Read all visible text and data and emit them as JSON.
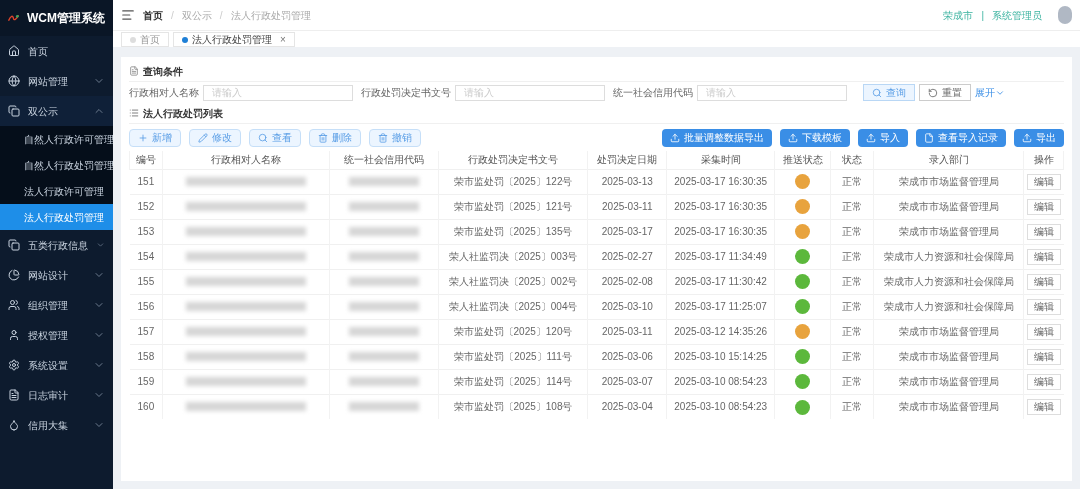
{
  "app": {
    "title": "WCM管理系统"
  },
  "sidebar": {
    "items": [
      {
        "label": "首页",
        "kind": "link"
      },
      {
        "label": "网站管理",
        "kind": "group",
        "expanded": false
      },
      {
        "label": "双公示",
        "kind": "group",
        "expanded": true,
        "children": [
          {
            "label": "自然人行政许可管理",
            "selected": false
          },
          {
            "label": "自然人行政处罚管理",
            "selected": false
          },
          {
            "label": "法人行政许可管理",
            "selected": false
          },
          {
            "label": "法人行政处罚管理",
            "selected": true
          }
        ]
      },
      {
        "label": "五类行政信息",
        "kind": "group",
        "expanded": false
      },
      {
        "label": "网站设计",
        "kind": "group",
        "expanded": false
      },
      {
        "label": "组织管理",
        "kind": "group",
        "expanded": false
      },
      {
        "label": "授权管理",
        "kind": "group",
        "expanded": false
      },
      {
        "label": "系统设置",
        "kind": "group",
        "expanded": false
      },
      {
        "label": "日志审计",
        "kind": "group",
        "expanded": false
      },
      {
        "label": "信用大集",
        "kind": "group",
        "expanded": false
      }
    ]
  },
  "breadcrumb": {
    "separator": "/",
    "items": [
      "首页",
      "双公示",
      "法人行政处罚管理"
    ]
  },
  "user": {
    "region": "荣成市",
    "separator": "|",
    "role": "系统管理员"
  },
  "tabs": [
    {
      "label": "首页",
      "selected": false
    },
    {
      "label": "法人行政处罚管理",
      "selected": true,
      "close": "×"
    }
  ],
  "query": {
    "title": "查询条件",
    "fields": [
      {
        "label": "行政相对人名称",
        "placeholder": "请输入"
      },
      {
        "label": "行政处罚决定书文号",
        "placeholder": "请输入"
      },
      {
        "label": "统一社会信用代码",
        "placeholder": "请输入"
      }
    ],
    "search_button": "查询",
    "reset_button": "重置",
    "expand_link": "展开"
  },
  "list": {
    "title": "法人行政处罚列表",
    "left_buttons": [
      "新增",
      "修改",
      "查看",
      "删除",
      "撤销"
    ],
    "right_buttons": [
      "批量调整数据导出",
      "下载模板",
      "导入",
      "查看导入记录",
      "导出"
    ]
  },
  "table": {
    "columns": [
      "编号",
      "行政相对人名称",
      "统一社会信用代码",
      "行政处罚决定书文号",
      "处罚决定日期",
      "采集时间",
      "推送状态",
      "状态",
      "录入部门",
      "操作"
    ],
    "rows": [
      {
        "id": "151",
        "doc_no": "荣市监处罚〔2025〕122号",
        "date": "2025-03-13",
        "collected": "2025-03-17 16:30:35",
        "color": "#e8a33d",
        "status": "正常",
        "dept": "荣成市市场监督管理局",
        "action": "编辑"
      },
      {
        "id": "152",
        "doc_no": "荣市监处罚〔2025〕121号",
        "date": "2025-03-11",
        "collected": "2025-03-17 16:30:35",
        "color": "#e8a33d",
        "status": "正常",
        "dept": "荣成市市场监督管理局",
        "action": "编辑"
      },
      {
        "id": "153",
        "doc_no": "荣市监处罚〔2025〕135号",
        "date": "2025-03-17",
        "collected": "2025-03-17 16:30:35",
        "color": "#e8a33d",
        "status": "正常",
        "dept": "荣成市市场监督管理局",
        "action": "编辑"
      },
      {
        "id": "154",
        "doc_no": "荣人社监罚决〔2025〕003号",
        "date": "2025-02-27",
        "collected": "2025-03-17 11:34:49",
        "color": "#5cb83c",
        "status": "正常",
        "dept": "荣成市人力资源和社会保障局",
        "action": "编辑"
      },
      {
        "id": "155",
        "doc_no": "荣人社监罚决〔2025〕002号",
        "date": "2025-02-08",
        "collected": "2025-03-17 11:30:42",
        "color": "#5cb83c",
        "status": "正常",
        "dept": "荣成市人力资源和社会保障局",
        "action": "编辑"
      },
      {
        "id": "156",
        "doc_no": "荣人社监罚决〔2025〕004号",
        "date": "2025-03-10",
        "collected": "2025-03-17 11:25:07",
        "color": "#5cb83c",
        "status": "正常",
        "dept": "荣成市人力资源和社会保障局",
        "action": "编辑"
      },
      {
        "id": "157",
        "doc_no": "荣市监处罚〔2025〕120号",
        "date": "2025-03-11",
        "collected": "2025-03-12 14:35:26",
        "color": "#e8a33d",
        "status": "正常",
        "dept": "荣成市市场监督管理局",
        "action": "编辑"
      },
      {
        "id": "158",
        "doc_no": "荣市监处罚〔2025〕111号",
        "date": "2025-03-06",
        "collected": "2025-03-10 15:14:25",
        "color": "#5cb83c",
        "status": "正常",
        "dept": "荣成市市场监督管理局",
        "action": "编辑"
      },
      {
        "id": "159",
        "doc_no": "荣市监处罚〔2025〕114号",
        "date": "2025-03-07",
        "collected": "2025-03-10 08:54:23",
        "color": "#5cb83c",
        "status": "正常",
        "dept": "荣成市市场监督管理局",
        "action": "编辑"
      },
      {
        "id": "160",
        "doc_no": "荣市监处罚〔2025〕108号",
        "date": "2025-03-04",
        "collected": "2025-03-10 08:54:23",
        "color": "#5cb83c",
        "status": "正常",
        "dept": "荣成市市场监督管理局",
        "action": "编辑"
      }
    ]
  }
}
